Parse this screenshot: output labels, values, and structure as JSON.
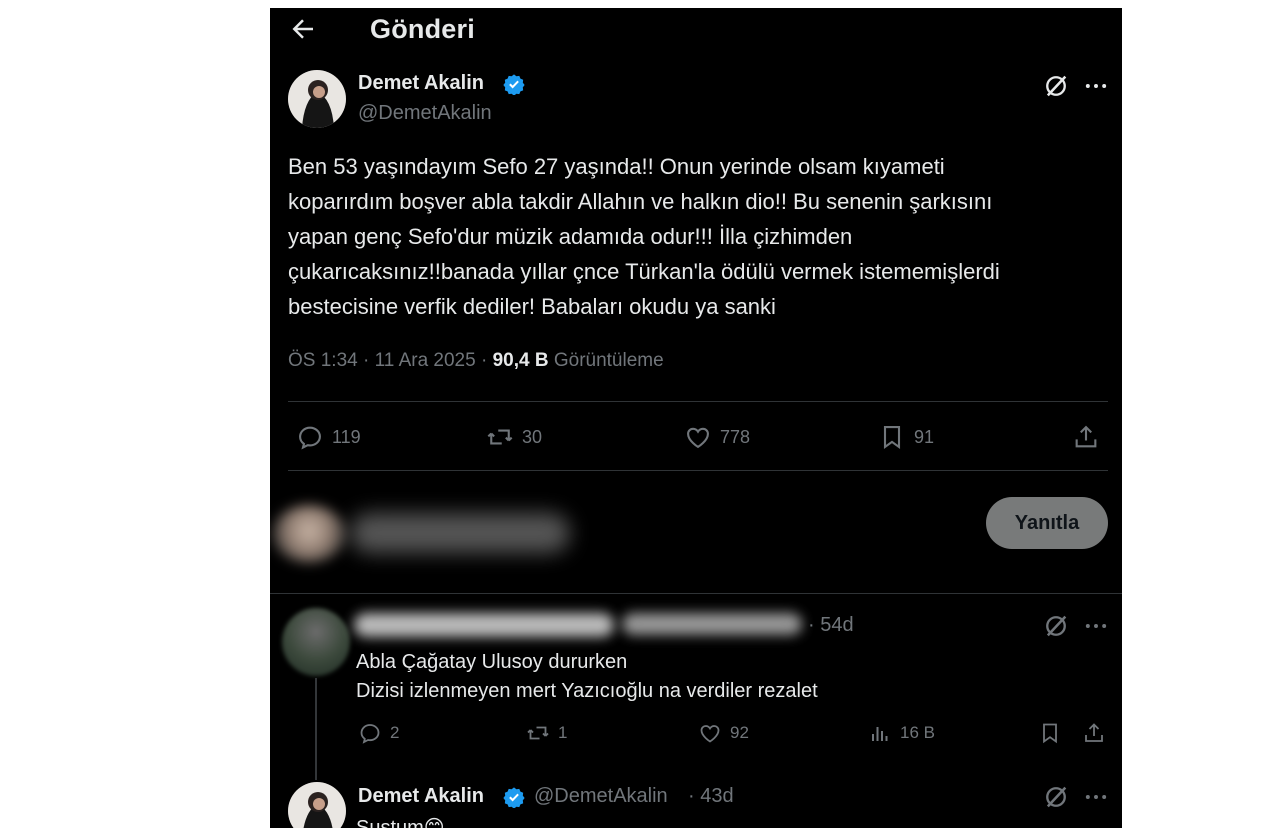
{
  "header": {
    "title": "Gönderi"
  },
  "tweet": {
    "author_name": "Demet Akalin",
    "author_handle": "@DemetAkalin",
    "text_lines": [
      "Ben 53 yaşındayım Sefo 27 yaşında!! Onun yerinde olsam kıyameti",
      "koparırdım boşver abla takdir Allahın ve halkın dio!! Bu senenin şarkısını",
      "yapan genç Sefo'dur müzik adamıda odur!!! İlla çizhimden",
      "çukarıcaksınız!!banada yıllar çnce Türkan'la ödülü vermek istememişlerdi",
      "bestecisine verfik dediler! Babaları okudu ya sanki"
    ],
    "time": "ÖS 1:34",
    "date": "11 Ara 2025",
    "views": "90,4 B",
    "views_label": "Görüntüleme",
    "stats": {
      "replies": "119",
      "retweets": "30",
      "likes": "778",
      "bookmarks": "91"
    }
  },
  "reply_composer": {
    "button_label": "Yanıtla"
  },
  "replies": [
    {
      "time": "· 54d",
      "text_lines": [
        "Abla Çağatay Ulusoy dururken",
        "Dizisi izlenmeyen mert Yazıcıoğlu na verdiler rezalet"
      ],
      "stats": {
        "replies": "2",
        "retweets": "1",
        "likes": "92",
        "views": "16 B"
      }
    },
    {
      "author_name": "Demet Akalin",
      "author_handle": "@DemetAkalin",
      "time": "· 43d",
      "text": "Sustum😊"
    }
  ],
  "colors": {
    "background": "#000000",
    "text": "#e7e9ea",
    "muted": "#71767b",
    "verified": "#1d9bf0",
    "divider": "#2f3336"
  }
}
